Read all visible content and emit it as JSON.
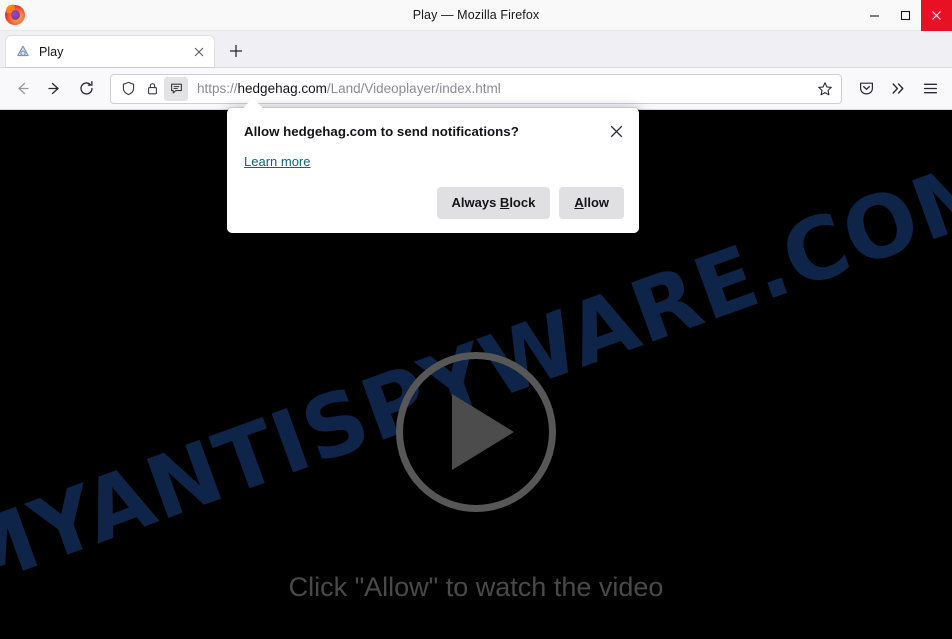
{
  "window": {
    "title": "Play — Mozilla Firefox",
    "app_icon": "firefox-logo",
    "controls": {
      "minimize": "minimize-icon",
      "maximize": "maximize-icon",
      "close": "close-icon",
      "close_color": "#e81123"
    }
  },
  "tabbar": {
    "tabs": [
      {
        "label": "Play",
        "favicon": "site-favicon",
        "close": "tab-close-icon"
      }
    ],
    "new_tab": "+"
  },
  "toolbar": {
    "back": "back-arrow-icon",
    "forward": "forward-arrow-icon",
    "reload": "reload-icon",
    "shield": "shield-icon",
    "lock": "lock-icon",
    "permission": "notification-permission-icon",
    "bookmark": "bookmark-star-icon",
    "pocket": "pocket-icon",
    "overflow": "double-chevron-icon",
    "menu": "hamburger-menu-icon",
    "url": {
      "scheme": "https://",
      "host": "hedgehag.com",
      "path": "/Land/Videoplayer/index.html",
      "full": "https://hedgehag.com/Land/Videoplayer/index.html"
    }
  },
  "doorhanger": {
    "title": "Allow hedgehag.com to send notifications?",
    "learn_more": "Learn more",
    "close": "close-icon",
    "buttons": {
      "block_prefix": "Always ",
      "block_key": "B",
      "block_suffix": "lock",
      "allow_key": "A",
      "allow_suffix": "llow"
    }
  },
  "page": {
    "background_color": "#000000",
    "watermark": "MYANTISPYWARE.COM",
    "watermark_color": "#0e2448",
    "play_button": "play-button-icon",
    "cta_text": "Click \"Allow\" to watch the video",
    "cta_color": "#494949"
  }
}
